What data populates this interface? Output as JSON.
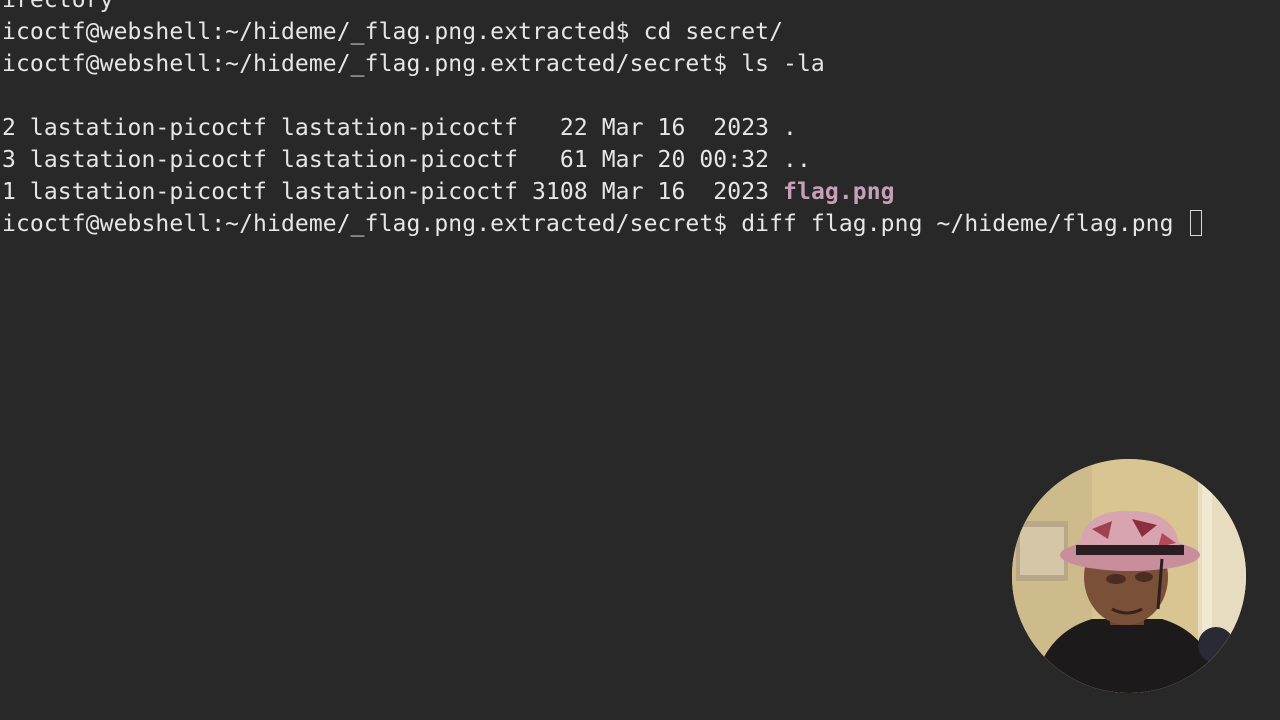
{
  "terminal": {
    "lines": [
      "irectory",
      "icoctf@webshell:~/hideme/_flag.png.extracted$ cd secret/",
      "icoctf@webshell:~/hideme/_flag.png.extracted/secret$ ls -la",
      "2 lastation-picoctf lastation-picoctf   22 Mar 16  2023 .",
      "3 lastation-picoctf lastation-picoctf   61 Mar 20 00:32 ..",
      "1 lastation-picoctf lastation-picoctf 3108 Mar 16  2023 ",
      "icoctf@webshell:~/hideme/_flag.png.extracted/secret$ diff flag.png ~/hideme/flag.png "
    ],
    "highlighted_file": "flag.png",
    "colors": {
      "background": "#282828",
      "text": "#e6e6e6",
      "highlight": "#c7a0b8"
    }
  },
  "webcam": {
    "icon": "webcam-overlay"
  }
}
